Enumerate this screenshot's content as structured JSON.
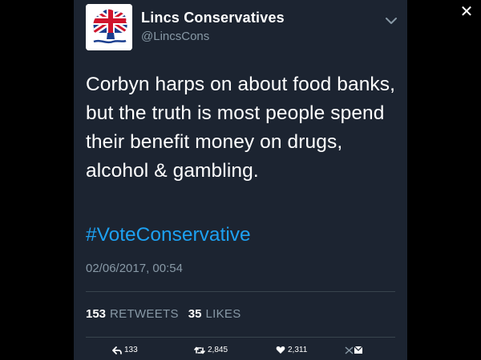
{
  "user": {
    "display_name": "Lincs Conservatives",
    "handle": "@LincsCons"
  },
  "tweet": {
    "text": "Corbyn harps on about food banks, but the truth is most people spend their benefit money on drugs, alcohol & gambling.",
    "hashtag": "#VoteConservative",
    "timestamp": "02/06/2017, 00:54"
  },
  "stats": {
    "retweets_count": "153",
    "retweets_label": "RETWEETS",
    "likes_count": "35",
    "likes_label": "LIKES"
  },
  "actions": {
    "reply_count": "133",
    "retweet_count": "2,845",
    "like_count": "2,311"
  },
  "colors": {
    "panel_bg": "#1c2431",
    "hashtag": "#1da1f2",
    "muted": "#8899a6",
    "divider": "#38444d"
  },
  "icons": [
    "close-icon",
    "chevron-down-icon",
    "reply-icon",
    "retweet-icon",
    "heart-icon",
    "mail-icon"
  ]
}
